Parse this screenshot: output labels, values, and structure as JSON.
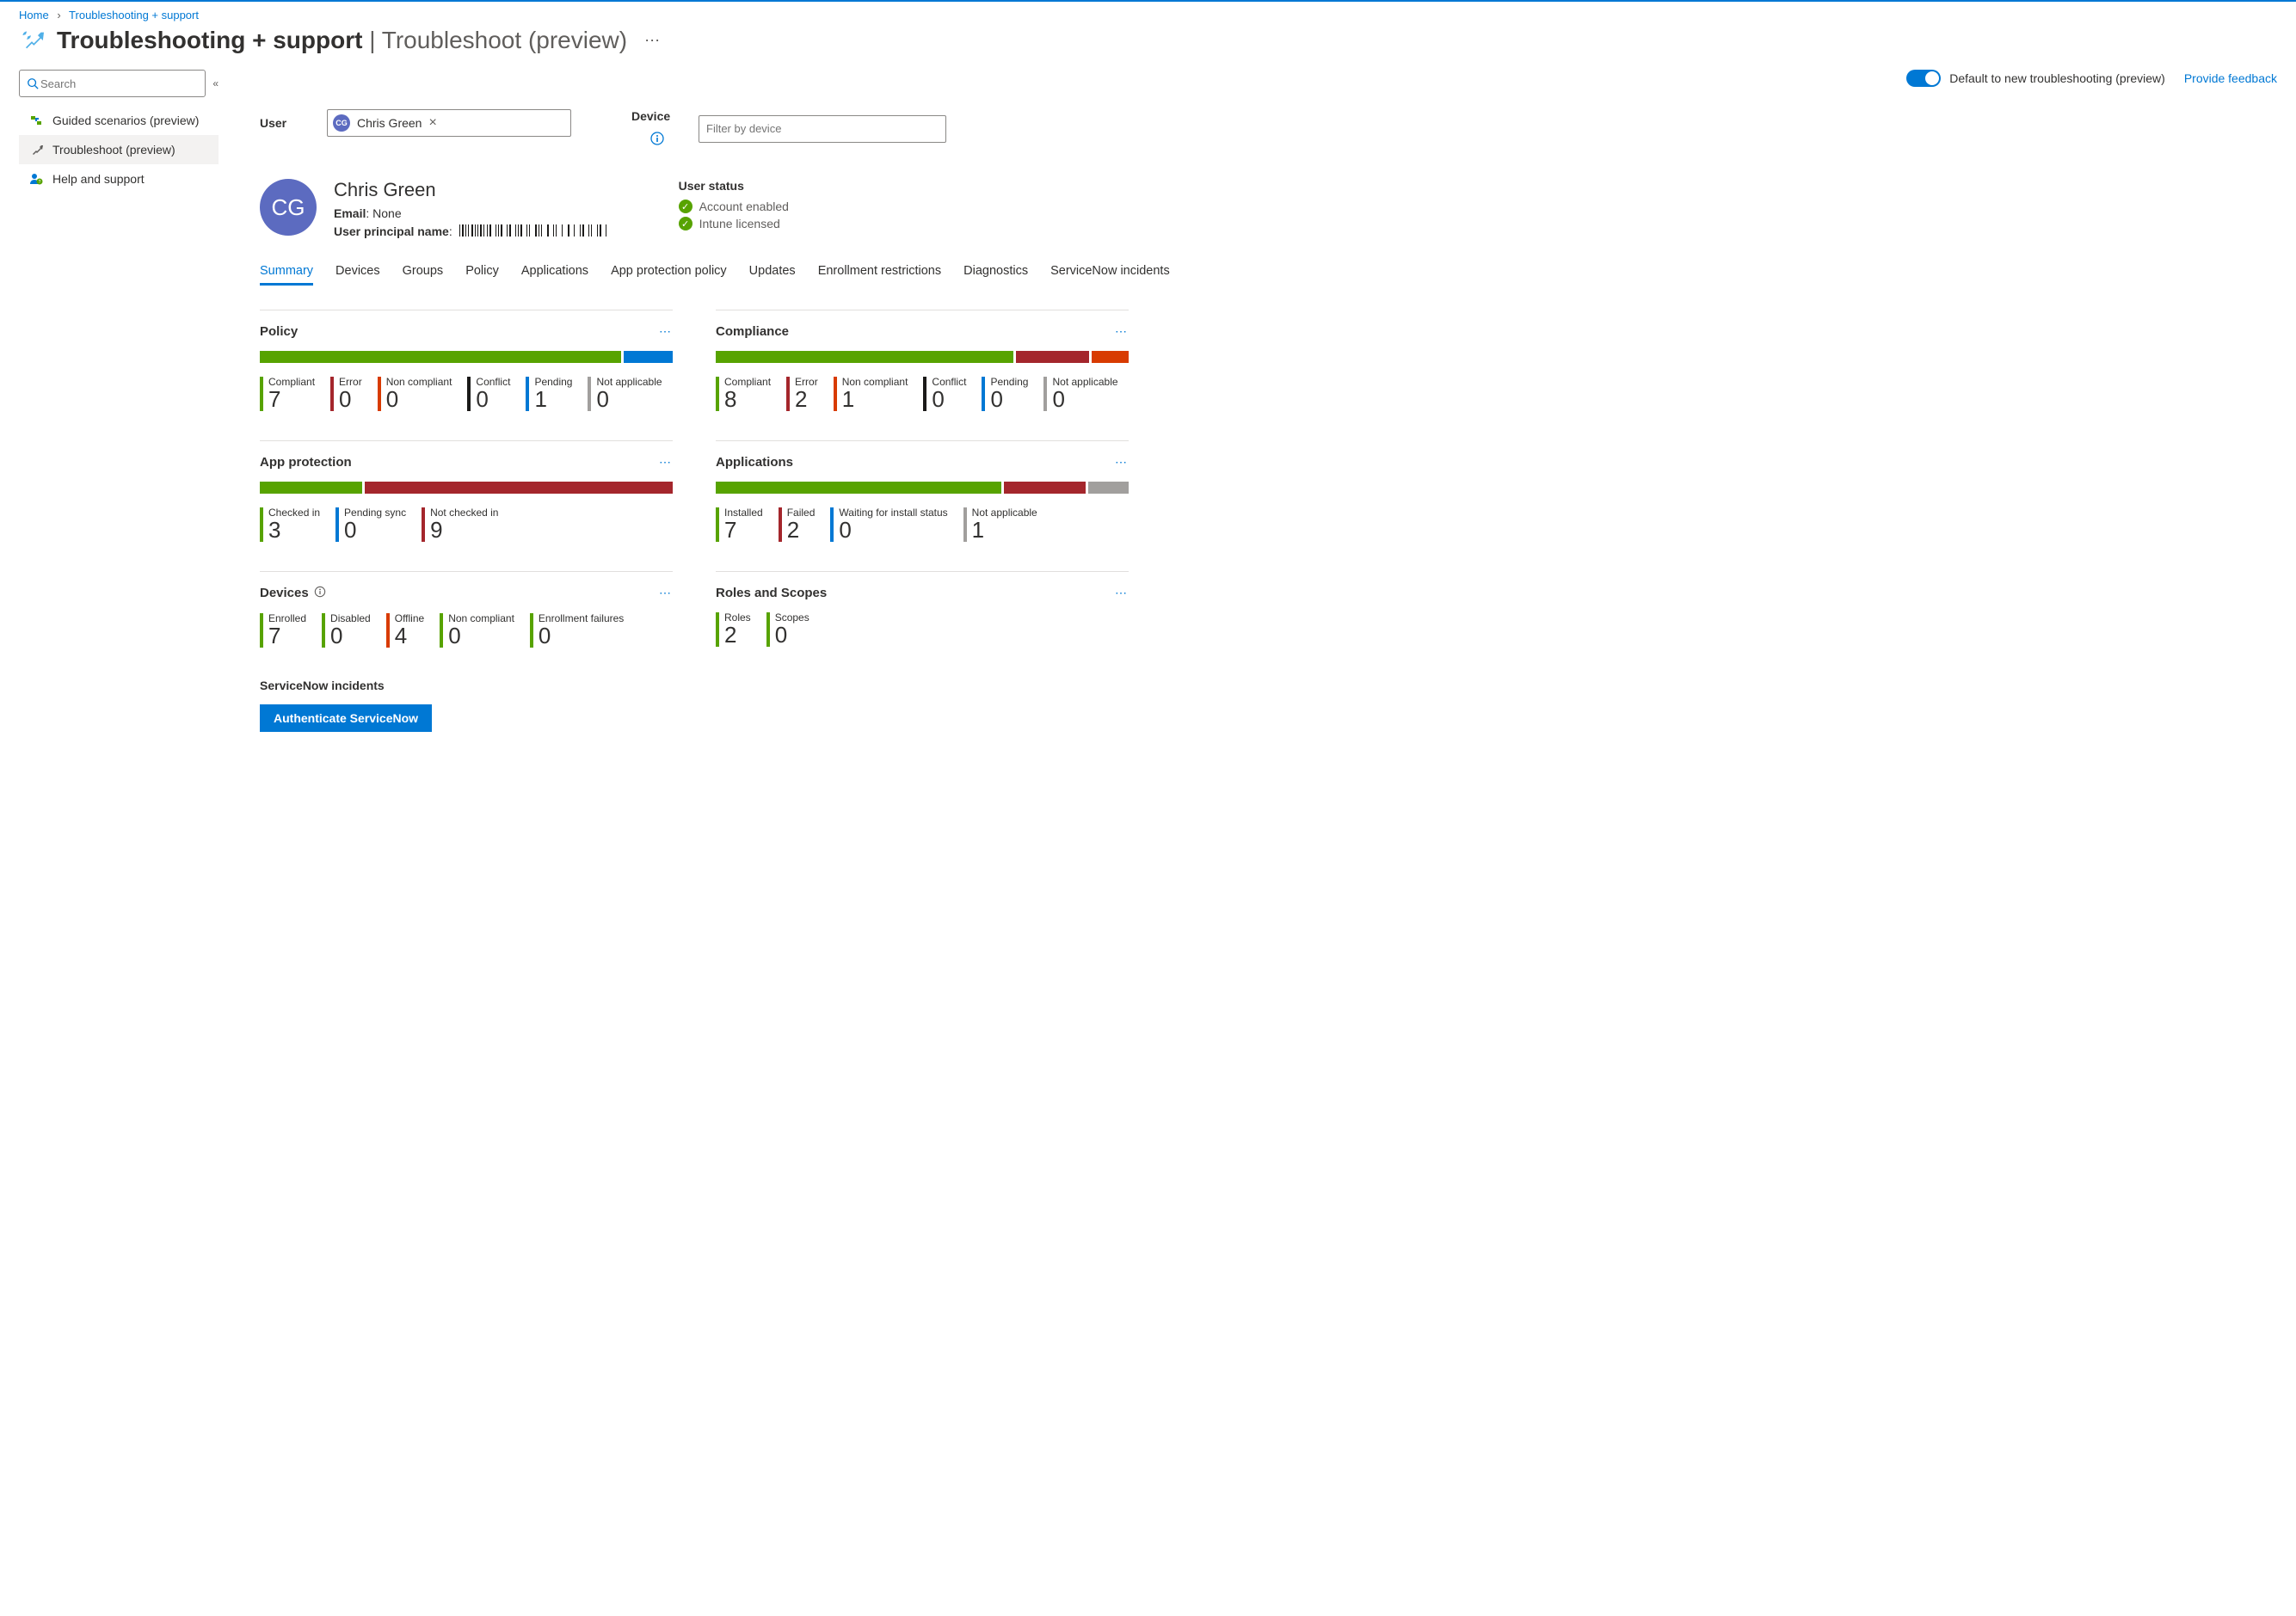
{
  "breadcrumb": {
    "home": "Home",
    "current": "Troubleshooting + support"
  },
  "page": {
    "title": "Troubleshooting + support",
    "subtitle": "Troubleshoot (preview)"
  },
  "sidebar": {
    "search_placeholder": "Search",
    "items": [
      {
        "label": "Guided scenarios (preview)"
      },
      {
        "label": "Troubleshoot (preview)"
      },
      {
        "label": "Help and support"
      }
    ]
  },
  "topbar": {
    "toggle_label": "Default to new troubleshooting (preview)",
    "feedback": "Provide feedback"
  },
  "filters": {
    "user_label": "User",
    "user_chip": "Chris Green",
    "user_initials": "CG",
    "device_label": "Device",
    "device_placeholder": "Filter by device"
  },
  "user": {
    "initials": "CG",
    "name": "Chris Green",
    "email_label": "Email",
    "email_value": "None",
    "upn_label": "User principal name",
    "status_title": "User status",
    "status1": "Account enabled",
    "status2": "Intune licensed"
  },
  "tabs": [
    "Summary",
    "Devices",
    "Groups",
    "Policy",
    "Applications",
    "App protection policy",
    "Updates",
    "Enrollment restrictions",
    "Diagnostics",
    "ServiceNow incidents"
  ],
  "cards": {
    "policy": {
      "title": "Policy",
      "segments": [
        [
          "green",
          88
        ],
        [
          "blue",
          12
        ]
      ],
      "metrics": [
        [
          "Compliant",
          "7",
          "green"
        ],
        [
          "Error",
          "0",
          "red"
        ],
        [
          "Non compliant",
          "0",
          "orange"
        ],
        [
          "Conflict",
          "0",
          "black"
        ],
        [
          "Pending",
          "1",
          "blue"
        ],
        [
          "Not applicable",
          "0",
          "gray"
        ]
      ]
    },
    "compliance": {
      "title": "Compliance",
      "segments": [
        [
          "green",
          73
        ],
        [
          "red",
          18
        ],
        [
          "orange",
          9
        ]
      ],
      "metrics": [
        [
          "Compliant",
          "8",
          "green"
        ],
        [
          "Error",
          "2",
          "red"
        ],
        [
          "Non compliant",
          "1",
          "orange"
        ],
        [
          "Conflict",
          "0",
          "black"
        ],
        [
          "Pending",
          "0",
          "blue"
        ],
        [
          "Not applicable",
          "0",
          "gray"
        ]
      ]
    },
    "appprot": {
      "title": "App protection",
      "segments": [
        [
          "green",
          25
        ],
        [
          "red",
          75
        ]
      ],
      "metrics": [
        [
          "Checked in",
          "3",
          "green"
        ],
        [
          "Pending sync",
          "0",
          "blue"
        ],
        [
          "Not checked in",
          "9",
          "red"
        ]
      ]
    },
    "apps": {
      "title": "Applications",
      "segments": [
        [
          "green",
          70
        ],
        [
          "red",
          20
        ],
        [
          "gray",
          10
        ]
      ],
      "metrics": [
        [
          "Installed",
          "7",
          "green"
        ],
        [
          "Failed",
          "2",
          "red"
        ],
        [
          "Waiting for install status",
          "0",
          "blue"
        ],
        [
          "Not applicable",
          "1",
          "gray"
        ]
      ]
    },
    "devices": {
      "title": "Devices",
      "metrics": [
        [
          "Enrolled",
          "7",
          "green"
        ],
        [
          "Disabled",
          "0",
          "green"
        ],
        [
          "Offline",
          "4",
          "orange"
        ],
        [
          "Non compliant",
          "0",
          "green"
        ],
        [
          "Enrollment failures",
          "0",
          "green"
        ]
      ]
    },
    "roles": {
      "title": "Roles and Scopes",
      "metrics": [
        [
          "Roles",
          "2",
          "green"
        ],
        [
          "Scopes",
          "0",
          "green"
        ]
      ]
    }
  },
  "servicenow": {
    "title": "ServiceNow incidents",
    "button": "Authenticate ServiceNow"
  },
  "colors": {
    "green": "#57a300",
    "red": "#a4262c",
    "orange": "#d83b01",
    "black": "#1b1a19",
    "blue": "#0078d4",
    "gray": "#a19f9d"
  }
}
